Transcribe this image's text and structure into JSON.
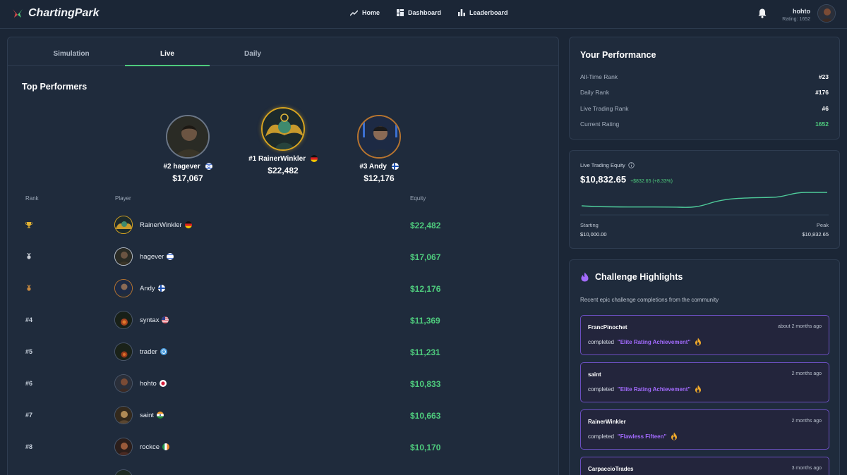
{
  "nav": {
    "brand": "ChartingPark",
    "links": [
      {
        "label": "Home",
        "icon": "chart-line-icon"
      },
      {
        "label": "Dashboard",
        "icon": "dashboard-icon"
      },
      {
        "label": "Leaderboard",
        "icon": "bar-chart-icon"
      }
    ],
    "user": {
      "name": "hohto",
      "rating": "Rating: 1652"
    }
  },
  "tabs": [
    {
      "label": "Simulation",
      "active": false
    },
    {
      "label": "Live",
      "active": true
    },
    {
      "label": "Daily",
      "active": false
    }
  ],
  "top_performers": {
    "title": "Top Performers",
    "podium": [
      {
        "rank": "#2",
        "name": "hagever",
        "equity": "$17,067",
        "flag": "il"
      },
      {
        "rank": "#1",
        "name": "RainerWinkler",
        "equity": "$22,482",
        "flag": "de"
      },
      {
        "rank": "#3",
        "name": "Andy",
        "equity": "$12,176",
        "flag": "fi"
      }
    ]
  },
  "table": {
    "headers": {
      "rank": "Rank",
      "player": "Player",
      "equity": "Equity"
    },
    "rows": [
      {
        "rank": "",
        "medal": "gold",
        "name": "RainerWinkler",
        "flag": "de",
        "equity": "$22,482"
      },
      {
        "rank": "",
        "medal": "silver",
        "name": "hagever",
        "flag": "il",
        "equity": "$17,067"
      },
      {
        "rank": "",
        "medal": "bronze",
        "name": "Andy",
        "flag": "fi",
        "equity": "$12,176"
      },
      {
        "rank": "#4",
        "medal": "",
        "name": "syntax",
        "flag": "us",
        "equity": "$11,369"
      },
      {
        "rank": "#5",
        "medal": "",
        "name": "trader",
        "flag": "un",
        "equity": "$11,231"
      },
      {
        "rank": "#6",
        "medal": "",
        "name": "hohto",
        "flag": "jp",
        "equity": "$10,833"
      },
      {
        "rank": "#7",
        "medal": "",
        "name": "saint",
        "flag": "in",
        "equity": "$10,663"
      },
      {
        "rank": "#8",
        "medal": "",
        "name": "rockce",
        "flag": "ie",
        "equity": "$10,170"
      }
    ]
  },
  "performance": {
    "title": "Your Performance",
    "rows": [
      {
        "label": "All-Time Rank",
        "value": "#23"
      },
      {
        "label": "Daily Rank",
        "value": "#176"
      },
      {
        "label": "Live Trading Rank",
        "value": "#6"
      },
      {
        "label": "Current Rating",
        "value": "1652"
      }
    ]
  },
  "equity_card": {
    "label": "Live Trading Equity",
    "value": "$10,832.65",
    "change": "+$832.65 (+8.33%)",
    "starting_label": "Starting",
    "starting_value": "$10,000.00",
    "peak_label": "Peak",
    "peak_value": "$10,832.65",
    "line_color": "#4ecb9a"
  },
  "challenges": {
    "title": "Challenge Highlights",
    "subtitle": "Recent epic challenge completions from the community",
    "items": [
      {
        "user": "FrancPinochet",
        "time": "about 2 months ago",
        "verb": "completed",
        "challenge": "\"Elite Rating Achievement\""
      },
      {
        "user": "saint",
        "time": "2 months ago",
        "verb": "completed",
        "challenge": "\"Elite Rating Achievement\""
      },
      {
        "user": "RainerWinkler",
        "time": "2 months ago",
        "verb": "completed",
        "challenge": "\"Flawless Fifteen\""
      },
      {
        "user": "CarpaccioTrades",
        "time": "3 months ago",
        "verb": "",
        "challenge": ""
      }
    ]
  },
  "colors": {
    "accent_green": "#4ecb7d",
    "challenge_purple": "#a36bff",
    "gold": "#d8a520"
  }
}
